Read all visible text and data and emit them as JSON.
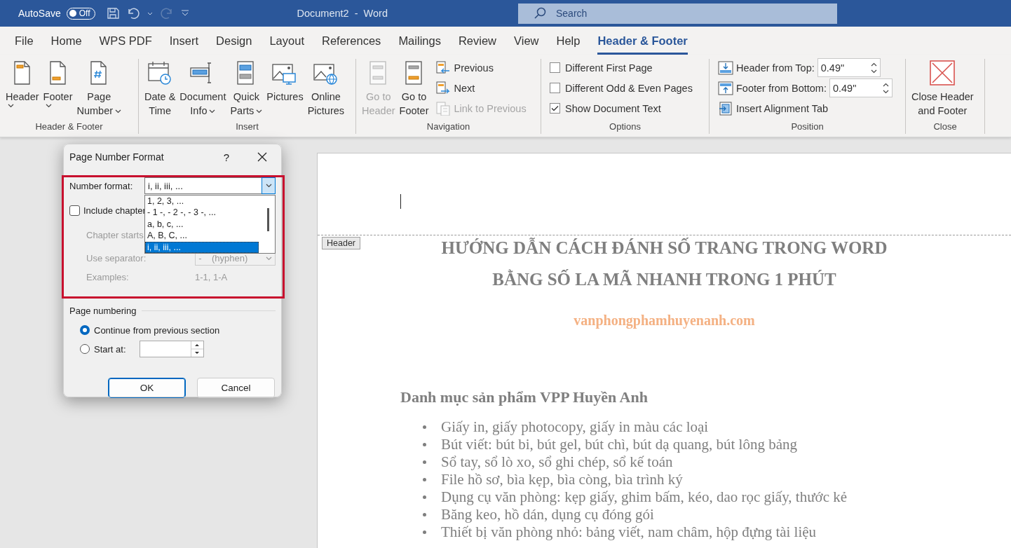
{
  "title_bar": {
    "autosave_label": "AutoSave",
    "autosave": {
      "label": "Off",
      "on": false
    },
    "document_title": "Document2  -  Word",
    "search": {
      "placeholder": "Search"
    }
  },
  "menu_tabs": [
    {
      "label": "File",
      "selected": false
    },
    {
      "label": "Home",
      "selected": false
    },
    {
      "label": "WPS PDF",
      "selected": false
    },
    {
      "label": "Insert",
      "selected": false
    },
    {
      "label": "Design",
      "selected": false
    },
    {
      "label": "Layout",
      "selected": false
    },
    {
      "label": "References",
      "selected": false
    },
    {
      "label": "Mailings",
      "selected": false
    },
    {
      "label": "Review",
      "selected": false
    },
    {
      "label": "View",
      "selected": false
    },
    {
      "label": "Help",
      "selected": false
    },
    {
      "label": "Header & Footer",
      "selected": true
    }
  ],
  "ribbon_groups": [
    {
      "label": "Header & Footer",
      "controls": [
        {
          "kind": "large",
          "label": "Header",
          "dropdown": true,
          "disabled": false
        },
        {
          "kind": "large",
          "label": "Footer",
          "dropdown": true,
          "disabled": false
        },
        {
          "kind": "large",
          "label": "Page\nNumber",
          "dropdown": true,
          "disabled": false
        }
      ]
    },
    {
      "label": "Insert",
      "controls": [
        {
          "kind": "large",
          "label": "Date &\nTime",
          "dropdown": false,
          "disabled": false
        },
        {
          "kind": "large",
          "label": "Document\nInfo",
          "dropdown": true,
          "disabled": false
        },
        {
          "kind": "large",
          "label": "Quick\nParts",
          "dropdown": true,
          "disabled": false
        },
        {
          "kind": "large",
          "label": "Pictures",
          "dropdown": false,
          "disabled": false
        },
        {
          "kind": "large",
          "label": "Online\nPictures",
          "dropdown": false,
          "disabled": false
        }
      ]
    },
    {
      "label": "Navigation",
      "controls": [
        {
          "kind": "large",
          "label": "Go to\nHeader",
          "dropdown": false,
          "disabled": true
        },
        {
          "kind": "large",
          "label": "Go to\nFooter",
          "dropdown": false,
          "disabled": false
        },
        {
          "kind": "small",
          "label": "Previous",
          "disabled": false
        },
        {
          "kind": "small",
          "label": "Next",
          "disabled": false
        },
        {
          "kind": "small",
          "label": "Link to Previous",
          "disabled": true
        }
      ]
    },
    {
      "label": "Options",
      "controls": [
        {
          "kind": "checkbox",
          "label": "Different First Page",
          "checked": false
        },
        {
          "kind": "checkbox",
          "label": "Different Odd & Even Pages",
          "checked": false
        },
        {
          "kind": "checkbox",
          "label": "Show Document Text",
          "checked": true
        }
      ]
    },
    {
      "label": "Position",
      "controls": [
        {
          "kind": "spinner",
          "label": "Header from Top:",
          "value": "0.49\""
        },
        {
          "kind": "spinner",
          "label": "Footer from Bottom:",
          "value": "0.49\""
        },
        {
          "kind": "small",
          "label": "Insert Alignment Tab",
          "disabled": false
        }
      ]
    },
    {
      "label": "Close",
      "controls": [
        {
          "kind": "large",
          "label": "Close Header\nand Footer",
          "dropdown": false,
          "disabled": false
        }
      ]
    }
  ],
  "dialog": {
    "title": "Page Number Format",
    "help": "?",
    "number_format": {
      "label": "Number format:",
      "value": "i, ii, iii, ...",
      "options": [
        {
          "label": "1, 2, 3, ...",
          "selected": false
        },
        {
          "label": "- 1 -, - 2 -, - 3 -, ...",
          "selected": false
        },
        {
          "label": "a, b, c, ...",
          "selected": false
        },
        {
          "label": "A, B, C, ...",
          "selected": false
        },
        {
          "label": "i, ii, iii, ...",
          "selected": true
        }
      ]
    },
    "include_chapter": {
      "label": "Include chapter",
      "checked": false
    },
    "chapter_starts": {
      "label": "Chapter starts",
      "disabled": true
    },
    "separator": {
      "label": "Use separator:",
      "value": "-    (hyphen)",
      "disabled": true
    },
    "examples": {
      "label": "Examples:",
      "value": "1-1, 1-A",
      "disabled": true
    },
    "page_numbering": {
      "label": "Page numbering",
      "options": [
        {
          "label": "Continue from previous section",
          "selected": true
        },
        {
          "label": "Start at:",
          "selected": false
        }
      ]
    },
    "buttons": [
      "OK",
      "Cancel"
    ]
  },
  "document": {
    "header_tag": "Header",
    "title_lines": [
      "HƯỚNG DẪN CÁCH ĐÁNH SỐ TRANG TRONG WORD",
      "BẰNG SỐ LA MÃ NHANH TRONG 1 PHÚT"
    ],
    "website": "vanphongphamhuyenanh.com",
    "heading": "Danh mục sản phẩm VPP Huyền Anh",
    "bullets": [
      "Giấy in, giấy photocopy, giấy in màu các loại",
      "Bút viết: bút bi, bút gel, bút chì, bút dạ quang, bút lông bảng",
      "Sổ tay, sổ lò xo, sổ ghi chép, sổ kế toán",
      "File hồ sơ, bìa kẹp, bìa còng, bìa trình ký",
      "Dụng cụ văn phòng: kẹp giấy, ghim bấm, kéo, dao rọc giấy, thước kẻ",
      "Băng keo, hồ dán, dụng cụ đóng gói",
      "Thiết bị văn phòng nhỏ: bảng viết, nam châm, hộp đựng tài liệu"
    ]
  }
}
